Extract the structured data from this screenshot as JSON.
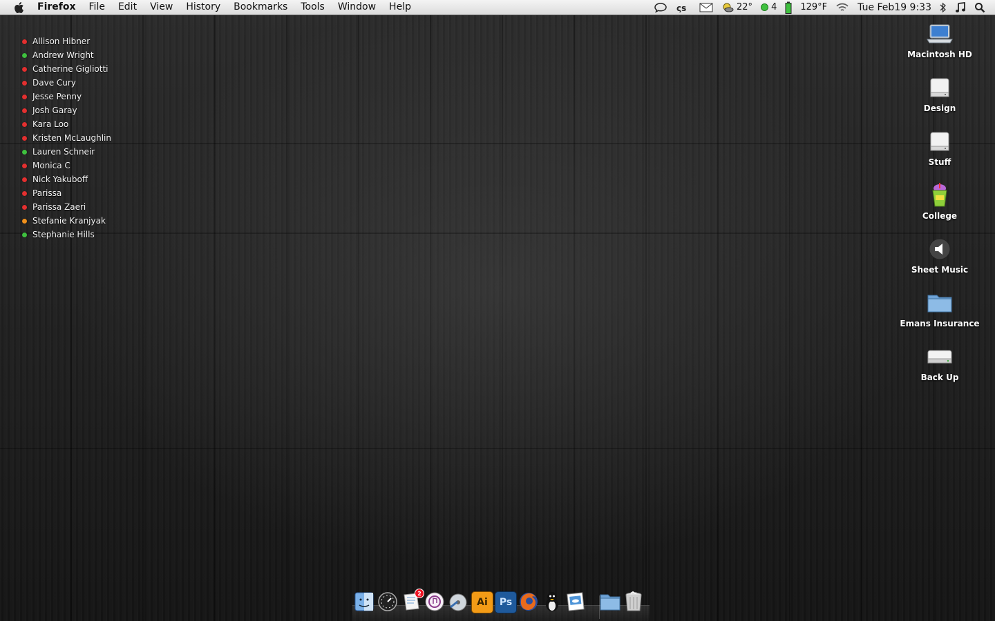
{
  "menubar": {
    "app_name": "Firefox",
    "menus": [
      "File",
      "Edit",
      "View",
      "History",
      "Bookmarks",
      "Tools",
      "Window",
      "Help"
    ],
    "status": {
      "weather_temp": "22°",
      "online_count": "4",
      "cpu_temp": "129°F",
      "clock": "Tue Feb19 9:33"
    }
  },
  "buddies": [
    {
      "name": "Allison Hibner",
      "status_color": "#e23030"
    },
    {
      "name": "Andrew Wright",
      "status_color": "#3fc03f"
    },
    {
      "name": "Catherine Gigliotti",
      "status_color": "#e23030"
    },
    {
      "name": "Dave Cury",
      "status_color": "#e23030"
    },
    {
      "name": "Jesse Penny",
      "status_color": "#e23030"
    },
    {
      "name": "Josh Garay",
      "status_color": "#e23030"
    },
    {
      "name": "Kara Loo",
      "status_color": "#e23030"
    },
    {
      "name": "Kristen McLaughlin",
      "status_color": "#e23030"
    },
    {
      "name": "Lauren Schneir",
      "status_color": "#3fc03f"
    },
    {
      "name": "Monica C",
      "status_color": "#e23030"
    },
    {
      "name": "Nick Yakuboff",
      "status_color": "#e23030"
    },
    {
      "name": "Parissa",
      "status_color": "#e23030"
    },
    {
      "name": "Parissa Zaeri",
      "status_color": "#e23030"
    },
    {
      "name": "Stefanie Kranjyak",
      "status_color": "#f0901c"
    },
    {
      "name": "Stephanie Hills",
      "status_color": "#3fc03f"
    }
  ],
  "desktop_icons": [
    {
      "label": "Macintosh HD",
      "icon": "laptop-drive-icon"
    },
    {
      "label": "Design",
      "icon": "drive-icon"
    },
    {
      "label": "Stuff",
      "icon": "drive-icon"
    },
    {
      "label": "College",
      "icon": "slushie-cup-icon"
    },
    {
      "label": "Sheet Music",
      "icon": "speaker-icon"
    },
    {
      "label": "Emans Insurance",
      "icon": "folder-icon"
    },
    {
      "label": "Back Up",
      "icon": "external-drive-icon"
    }
  ],
  "dock": {
    "items": [
      {
        "name": "finder-icon"
      },
      {
        "name": "dashboard-icon"
      },
      {
        "name": "mail-icon",
        "badge": "2"
      },
      {
        "name": "itunes-icon"
      },
      {
        "name": "disk-utility-icon"
      },
      {
        "name": "illustrator-icon",
        "text": "Ai"
      },
      {
        "name": "photoshop-icon",
        "text": "Ps"
      },
      {
        "name": "firefox-icon"
      },
      {
        "name": "adium-icon"
      },
      {
        "name": "preview-icon"
      },
      {
        "name": "documents-folder-icon"
      },
      {
        "name": "trash-icon"
      }
    ]
  },
  "colors": {
    "menubar_bg": "#e6e6e6",
    "online": "#3fc03f",
    "busy": "#e23030",
    "away": "#f0901c",
    "illustrator": "#f39b16",
    "photoshop": "#1f5a9c"
  }
}
